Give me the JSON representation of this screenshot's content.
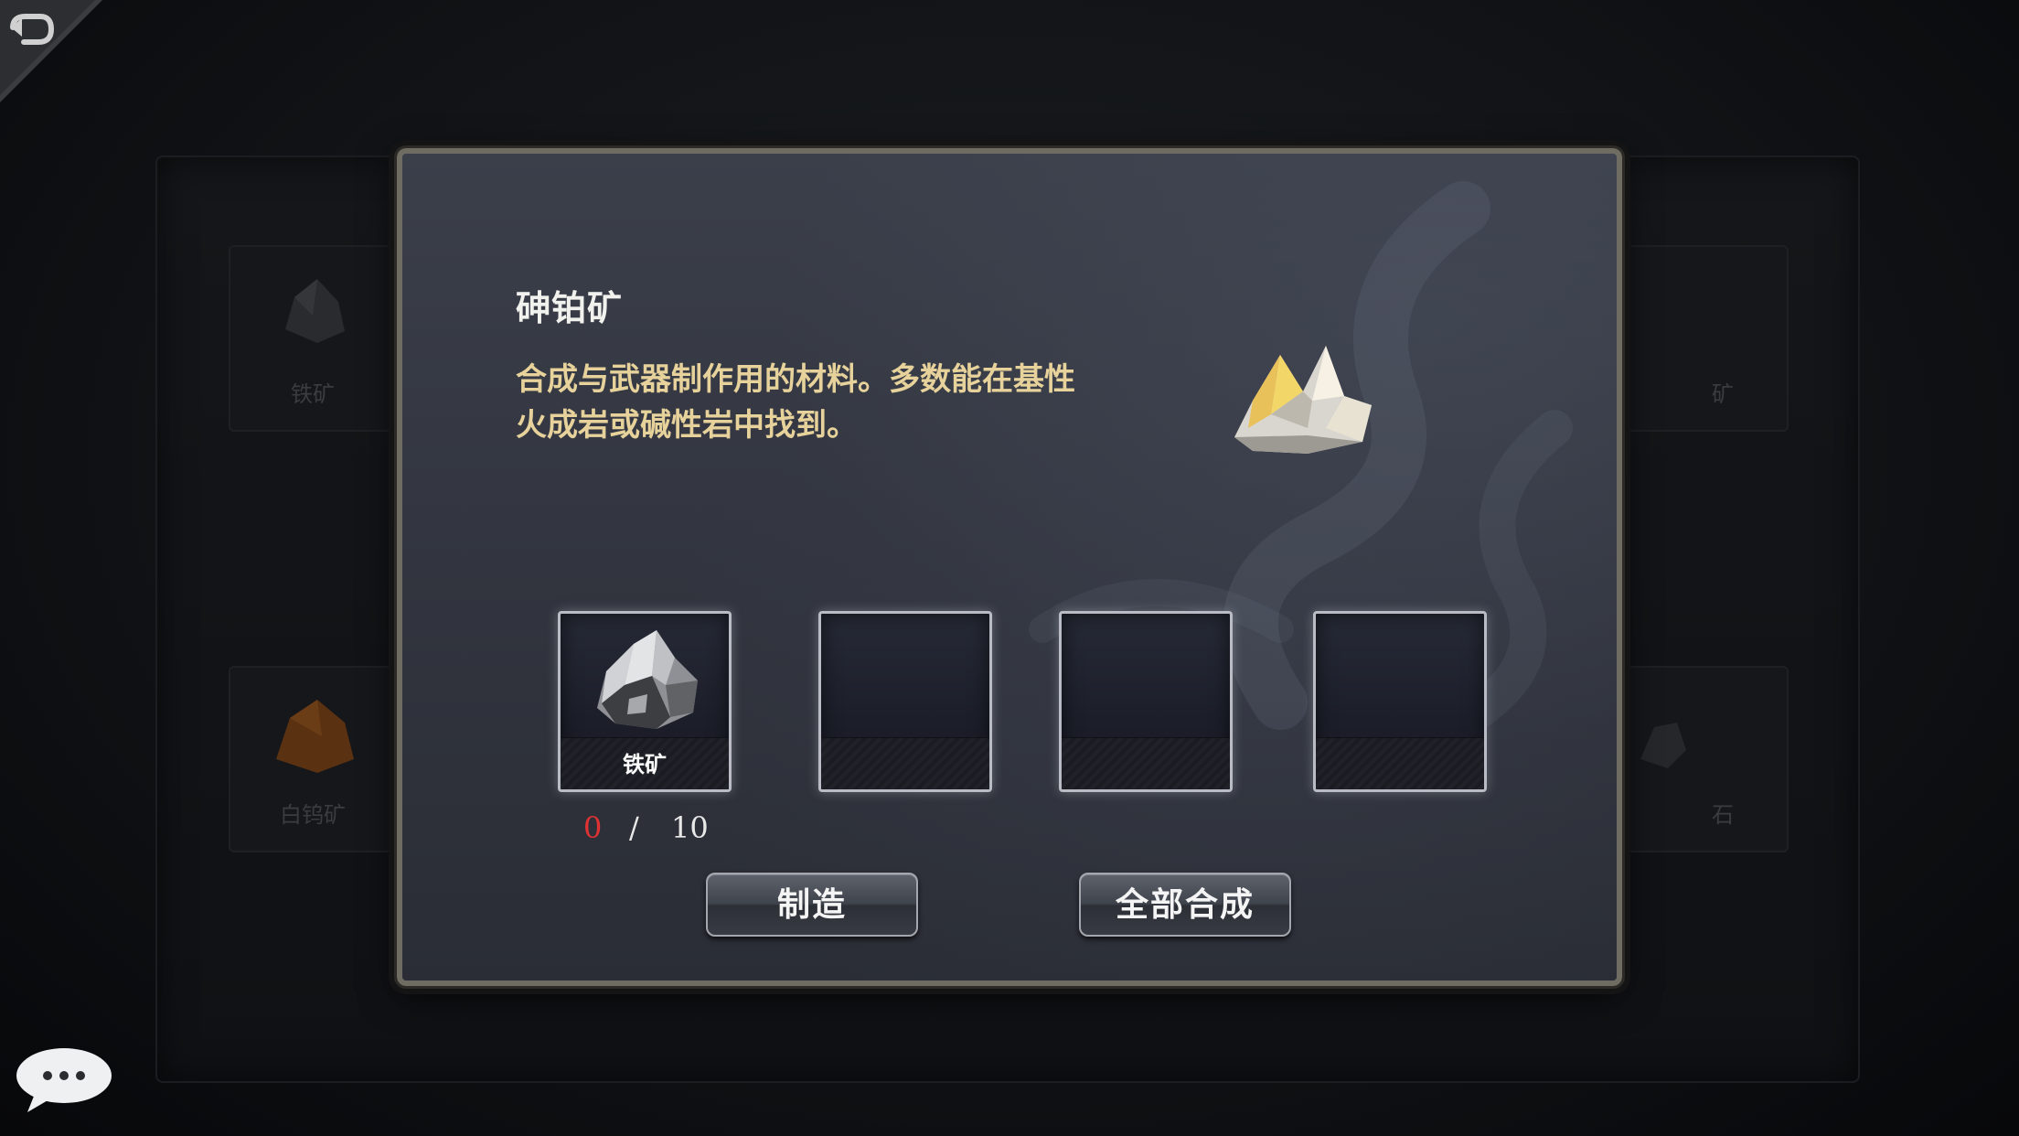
{
  "background": {
    "slots": [
      {
        "label": "铁矿",
        "icon": "iron-ore-icon"
      },
      {
        "label": "白钨矿",
        "icon": "scheelite-ore-icon"
      },
      {
        "label": "矿",
        "icon": "ore-icon"
      },
      {
        "label": "石",
        "icon": "stone-icon"
      }
    ]
  },
  "dialog": {
    "title": "砷铂矿",
    "description": "合成与武器制作用的材料。多数能在基性火成岩或碱性岩中找到。",
    "item_icon": "sperrylite-crystal-icon",
    "materials": [
      {
        "label": "铁矿",
        "icon": "iron-ore-icon"
      },
      {
        "label": "",
        "icon": ""
      },
      {
        "label": "",
        "icon": ""
      },
      {
        "label": "",
        "icon": ""
      }
    ],
    "count": {
      "have": "0",
      "separator": "/",
      "need": "10"
    },
    "buttons": {
      "craft": "制造",
      "craft_all": "全部合成"
    }
  },
  "colors": {
    "description": "#e6d29a",
    "insufficient": "#e03232",
    "frame": "#6f6c63"
  }
}
